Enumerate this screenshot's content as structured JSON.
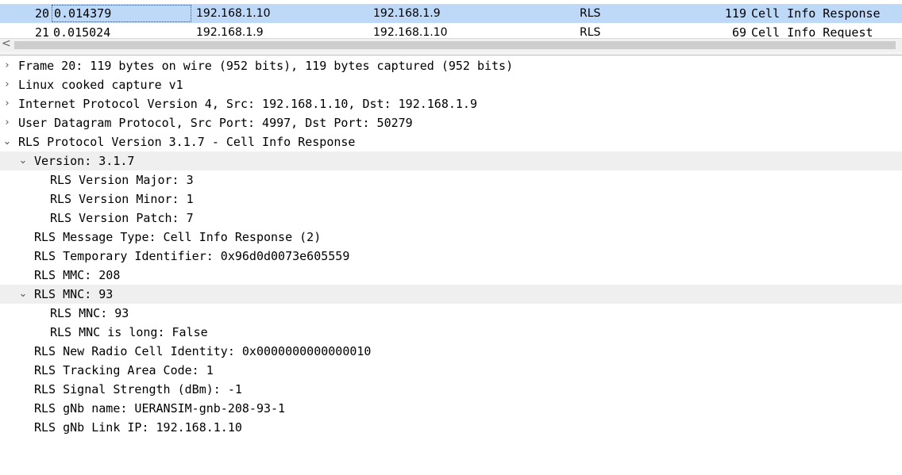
{
  "packet_list": {
    "rows": [
      {
        "no": "20",
        "time": "0.014379",
        "source": "192.168.1.10",
        "destination": "192.168.1.9",
        "protocol": "RLS",
        "length": "119",
        "info": "Cell Info Response",
        "selected": true
      },
      {
        "no": "21",
        "time": "0.015024",
        "source": "192.168.1.9",
        "destination": "192.168.1.10",
        "protocol": "RLS",
        "length": "69",
        "info": "Cell Info Request",
        "selected": false
      }
    ]
  },
  "scrollbar": {
    "left_arrow": "<"
  },
  "details": {
    "frame": "Frame 20: 119 bytes on wire (952 bits), 119 bytes captured (952 bits)",
    "linux_cooked": "Linux cooked capture v1",
    "ipv4": "Internet Protocol Version 4, Src: 192.168.1.10, Dst: 192.168.1.9",
    "udp": "User Datagram Protocol, Src Port: 4997, Dst Port: 50279",
    "rls": "RLS Protocol Version 3.1.7 - Cell Info Response",
    "version": "Version: 3.1.7",
    "version_major": "RLS Version Major: 3",
    "version_minor": "RLS Version Minor: 1",
    "version_patch": "RLS Version Patch: 7",
    "message_type": "RLS Message Type: Cell Info Response (2)",
    "temp_id": "RLS Temporary Identifier: 0x96d0d0073e605559",
    "mmc": "RLS MMC: 208",
    "mnc_group": "RLS MNC: 93",
    "mnc": "RLS MNC: 93",
    "mnc_long": "RLS MNC is long: False",
    "nr_cell_id": "RLS New Radio Cell Identity: 0x0000000000000010",
    "tac": "RLS Tracking Area Code: 1",
    "signal": "RLS Signal Strength (dBm): -1",
    "gnb_name": "RLS gNb name: UERANSIM-gnb-208-93-1",
    "gnb_ip": "RLS gNb Link IP: 192.168.1.10"
  },
  "icons": {
    "collapsed": "›",
    "expanded": "⌄"
  }
}
